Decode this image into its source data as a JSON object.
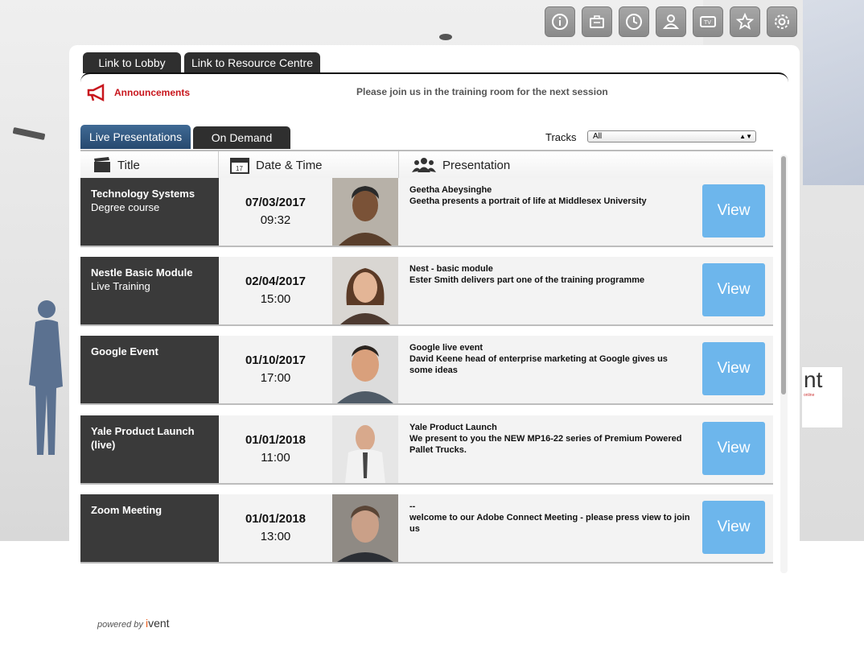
{
  "toolbar": {
    "icons": [
      "info-icon",
      "briefcase-icon",
      "clock-icon",
      "user-icon",
      "tv-icon",
      "star-icon",
      "gear-icon"
    ]
  },
  "top_tabs": [
    "Link to Lobby",
    "Link to Resource Centre"
  ],
  "announcements": {
    "label": "Announcements",
    "message": "Please join us in the training room for the next session"
  },
  "sub_tabs": {
    "live": "Live Presentations",
    "on_demand": "On Demand"
  },
  "tracks": {
    "label": "Tracks",
    "selected": "All"
  },
  "columns": {
    "title": "Title",
    "datetime": "Date & Time",
    "presentation": "Presentation",
    "calendar_day": "17"
  },
  "rows": [
    {
      "title": "Technology Systems",
      "subtitle": "Degree course",
      "date": "07/03/2017",
      "time": "09:32",
      "line1": "Geetha Abeysinghe",
      "line2": "Geetha presents a portrait of life at Middlesex University",
      "view": "View"
    },
    {
      "title": "Nestle Basic Module",
      "subtitle": "Live Training",
      "date": "02/04/2017",
      "time": "15:00",
      "line1": "Nest - basic module",
      "line2": "Ester Smith delivers part one of the training programme",
      "view": "View"
    },
    {
      "title": "Google Event",
      "subtitle": "",
      "date": "01/10/2017",
      "time": "17:00",
      "line1": "Google live event",
      "line2": "David Keene head of enterprise marketing at Google gives us some ideas",
      "view": "View"
    },
    {
      "title": "Yale Product Launch (live)",
      "subtitle": "",
      "date": "01/01/2018",
      "time": "11:00",
      "line1": "Yale Product Launch",
      "line2": "We present to you the NEW MP16-22 series of Premium Powered Pallet Trucks.",
      "view": "View"
    },
    {
      "title": "Zoom Meeting",
      "subtitle": "",
      "date": "01/01/2018",
      "time": "13:00",
      "line1": "--",
      "line2": "welcome to our Adobe Connect Meeting - please press view to join us",
      "view": "View"
    }
  ],
  "footer": {
    "powered_by": "powered by",
    "brand_i": "i",
    "brand_rest": "vent"
  },
  "background_sign": {
    "big": "nt",
    "small": "online"
  },
  "colors": {
    "view_button": "#6db6ec",
    "announcement": "#c8161d",
    "live_tab": "#2c4e74",
    "title_cell": "#3a3a3a"
  }
}
